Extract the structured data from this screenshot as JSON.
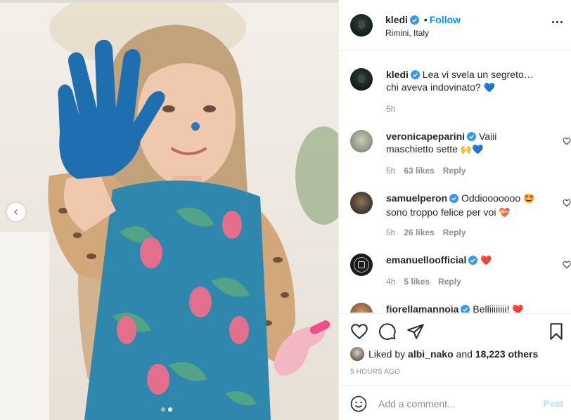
{
  "post": {
    "username": "kledi",
    "follow_label": "Follow",
    "separator": "•",
    "location": "Rimini, Italy"
  },
  "caption": {
    "username": "kledi",
    "text": "Lea vi svela un segreto…chi aveva indovinato?",
    "emoji": "💙",
    "time": "5h"
  },
  "comments": [
    {
      "username": "veronicapeparini",
      "text": "Vaiii maschietto sette",
      "emoji": "🙌💙",
      "time": "5h",
      "likes": "63 likes",
      "reply": "Reply"
    },
    {
      "username": "samuelperon",
      "text": "Oddiooooooo",
      "emoji_pre": "🤩",
      "text2": "sono troppo felice per voi",
      "emoji": "💝",
      "time": "5h",
      "likes": "26 likes",
      "reply": "Reply"
    },
    {
      "username": "emanuelloofficial",
      "text": "",
      "emoji": "❤️",
      "time": "4h",
      "likes": "5 likes",
      "reply": "Reply"
    },
    {
      "username": "fiorellamannoia",
      "text": "Belliiiiiiii!",
      "emoji": "❤️"
    }
  ],
  "likes": {
    "prefix": "Liked by",
    "user": "albi_nako",
    "conj": "and",
    "others": "18,223 others"
  },
  "timestamp": "5 HOURS AGO",
  "composer": {
    "placeholder": "Add a comment...",
    "post_label": "Post"
  },
  "colors": {
    "accent": "#0095f6",
    "verified": "#3897f0",
    "meta": "#8e8e8e",
    "like_red": "#ed4956",
    "post_disabled": "#b2dffc"
  },
  "icons": [
    "chevron-left-icon",
    "verified-badge-icon",
    "more-icon",
    "heart-icon",
    "comment-icon",
    "share-icon",
    "bookmark-icon",
    "emoji-icon"
  ]
}
